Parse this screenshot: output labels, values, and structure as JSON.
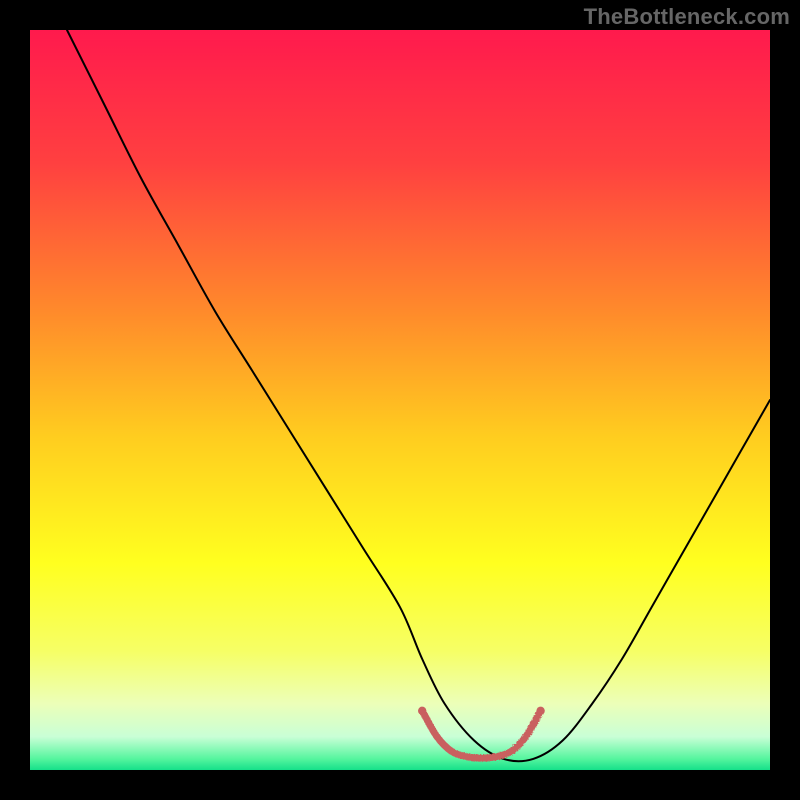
{
  "watermark": "TheBottleneck.com",
  "chart_data": {
    "type": "line",
    "title": "",
    "xlabel": "",
    "ylabel": "",
    "xlim": [
      0,
      100
    ],
    "ylim": [
      0,
      100
    ],
    "grid": false,
    "legend": false,
    "background_gradient_stops": [
      {
        "offset": 0.0,
        "color": "#ff1a4d"
      },
      {
        "offset": 0.18,
        "color": "#ff4040"
      },
      {
        "offset": 0.38,
        "color": "#ff8a2b"
      },
      {
        "offset": 0.55,
        "color": "#ffcd1f"
      },
      {
        "offset": 0.72,
        "color": "#ffff1f"
      },
      {
        "offset": 0.84,
        "color": "#f6ff66"
      },
      {
        "offset": 0.91,
        "color": "#ecffb8"
      },
      {
        "offset": 0.955,
        "color": "#c9ffd6"
      },
      {
        "offset": 0.985,
        "color": "#55f59e"
      },
      {
        "offset": 1.0,
        "color": "#15e08a"
      }
    ],
    "series": [
      {
        "name": "bottleneck-curve",
        "color": "#000000",
        "width": 2,
        "x": [
          5,
          10,
          15,
          20,
          25,
          30,
          35,
          40,
          45,
          50,
          53,
          56,
          60,
          64,
          68,
          72,
          76,
          80,
          84,
          88,
          92,
          96,
          100
        ],
        "y": [
          100,
          90,
          80,
          71,
          62,
          54,
          46,
          38,
          30,
          22,
          15,
          9,
          4,
          1.5,
          1.5,
          4,
          9,
          15,
          22,
          29,
          36,
          43,
          50
        ]
      },
      {
        "name": "bottom-marker",
        "color": "#c9605f",
        "width": 7,
        "style": "rough",
        "x": [
          53,
          55,
          57,
          59,
          61,
          63,
          65,
          67,
          69
        ],
        "y": [
          8,
          4.5,
          2.5,
          1.8,
          1.6,
          1.8,
          2.5,
          4.5,
          8
        ]
      }
    ]
  }
}
